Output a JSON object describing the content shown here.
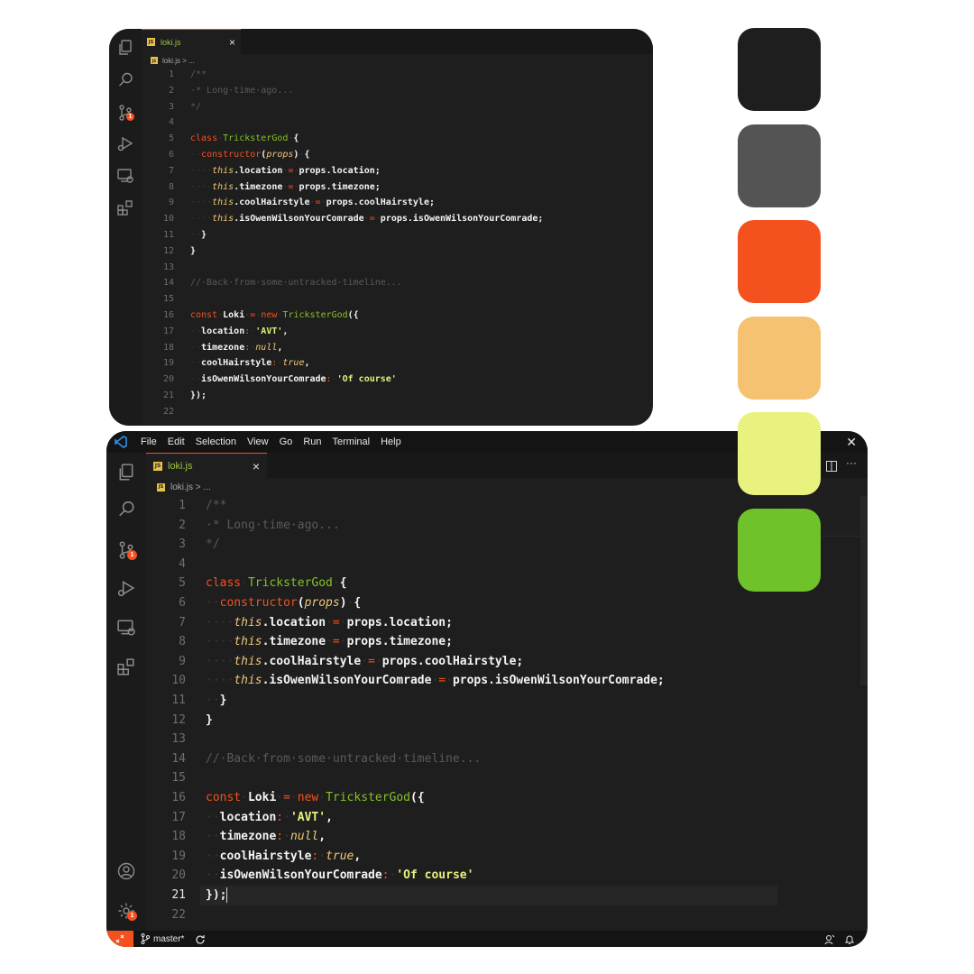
{
  "tab": {
    "file": "loki.js",
    "close": "×",
    "file_icon": "JS"
  },
  "breadcrumb": "loki.js > ...",
  "menu": [
    "File",
    "Edit",
    "Selection",
    "View",
    "Go",
    "Run",
    "Terminal",
    "Help"
  ],
  "window_close": "✕",
  "badges": {
    "scm": "1",
    "settings": "1"
  },
  "status": {
    "branch": "master*"
  },
  "editor": {
    "active_line": 21,
    "lines": [
      {
        "n": 1,
        "t": [
          [
            "cm",
            "/**"
          ]
        ]
      },
      {
        "n": 2,
        "t": [
          [
            "cm",
            "·* Long·time·ago..."
          ]
        ]
      },
      {
        "n": 3,
        "t": [
          [
            "cm",
            "*/"
          ]
        ]
      },
      {
        "n": 4,
        "t": []
      },
      {
        "n": 5,
        "t": [
          [
            "k",
            "class"
          ],
          [
            "ws",
            "·"
          ],
          [
            "cl",
            "TricksterGod"
          ],
          [
            "ws",
            "·"
          ],
          [
            "pu",
            "{"
          ]
        ]
      },
      {
        "n": 6,
        "t": [
          [
            "ws",
            "··"
          ],
          [
            "fn",
            "constructor"
          ],
          [
            "pu",
            "("
          ],
          [
            "pa",
            "props"
          ],
          [
            "pu",
            ")"
          ],
          [
            "ws",
            "·"
          ],
          [
            "pu",
            "{"
          ]
        ]
      },
      {
        "n": 7,
        "t": [
          [
            "ws",
            "····"
          ],
          [
            "th",
            "this"
          ],
          [
            "id",
            ".location"
          ],
          [
            "ws",
            "·"
          ],
          [
            "op",
            "="
          ],
          [
            "ws",
            "·"
          ],
          [
            "id",
            "props.location;"
          ]
        ]
      },
      {
        "n": 8,
        "t": [
          [
            "ws",
            "····"
          ],
          [
            "th",
            "this"
          ],
          [
            "id",
            ".timezone"
          ],
          [
            "ws",
            "·"
          ],
          [
            "op",
            "="
          ],
          [
            "ws",
            "·"
          ],
          [
            "id",
            "props.timezone;"
          ]
        ]
      },
      {
        "n": 9,
        "t": [
          [
            "ws",
            "····"
          ],
          [
            "th",
            "this"
          ],
          [
            "id",
            ".coolHairstyle"
          ],
          [
            "ws",
            "·"
          ],
          [
            "op",
            "="
          ],
          [
            "ws",
            "·"
          ],
          [
            "id",
            "props.coolHairstyle;"
          ]
        ]
      },
      {
        "n": 10,
        "t": [
          [
            "ws",
            "····"
          ],
          [
            "th",
            "this"
          ],
          [
            "id",
            ".isOwenWilsonYourComrade"
          ],
          [
            "ws",
            "·"
          ],
          [
            "op",
            "="
          ],
          [
            "ws",
            "·"
          ],
          [
            "id",
            "props.isOwenWilsonYourComrade;"
          ]
        ]
      },
      {
        "n": 11,
        "t": [
          [
            "ws",
            "··"
          ],
          [
            "pu",
            "}"
          ]
        ]
      },
      {
        "n": 12,
        "t": [
          [
            "pu",
            "}"
          ]
        ]
      },
      {
        "n": 13,
        "t": []
      },
      {
        "n": 14,
        "t": [
          [
            "cm",
            "//·Back·from·some·untracked·timeline..."
          ]
        ]
      },
      {
        "n": 15,
        "t": []
      },
      {
        "n": 16,
        "t": [
          [
            "k",
            "const"
          ],
          [
            "ws",
            "·"
          ],
          [
            "id",
            "Loki"
          ],
          [
            "ws",
            "·"
          ],
          [
            "op",
            "="
          ],
          [
            "ws",
            "·"
          ],
          [
            "k",
            "new"
          ],
          [
            "ws",
            "·"
          ],
          [
            "cl",
            "TricksterGod"
          ],
          [
            "pu",
            "({"
          ]
        ]
      },
      {
        "n": 17,
        "t": [
          [
            "ws",
            "··"
          ],
          [
            "id",
            "location"
          ],
          [
            "op",
            ":"
          ],
          [
            "ws",
            "·"
          ],
          [
            "st",
            "'AVT'"
          ],
          [
            "pu",
            ","
          ]
        ]
      },
      {
        "n": 18,
        "t": [
          [
            "ws",
            "··"
          ],
          [
            "id",
            "timezone"
          ],
          [
            "op",
            ":"
          ],
          [
            "ws",
            "·"
          ],
          [
            "pa",
            "null"
          ],
          [
            "pu",
            ","
          ]
        ]
      },
      {
        "n": 19,
        "t": [
          [
            "ws",
            "··"
          ],
          [
            "id",
            "coolHairstyle"
          ],
          [
            "op",
            ":"
          ],
          [
            "ws",
            "·"
          ],
          [
            "pa",
            "true"
          ],
          [
            "pu",
            ","
          ]
        ]
      },
      {
        "n": 20,
        "t": [
          [
            "ws",
            "··"
          ],
          [
            "id",
            "isOwenWilsonYourComrade"
          ],
          [
            "op",
            ":"
          ],
          [
            "ws",
            "·"
          ],
          [
            "st",
            "'Of course'"
          ]
        ]
      },
      {
        "n": 21,
        "t": [
          [
            "pu",
            "});"
          ]
        ]
      },
      {
        "n": 22,
        "t": []
      }
    ]
  },
  "palette": [
    "#1e1e1e",
    "#545454",
    "#f4511e",
    "#f5c272",
    "#eaf27f",
    "#6fc22a"
  ]
}
